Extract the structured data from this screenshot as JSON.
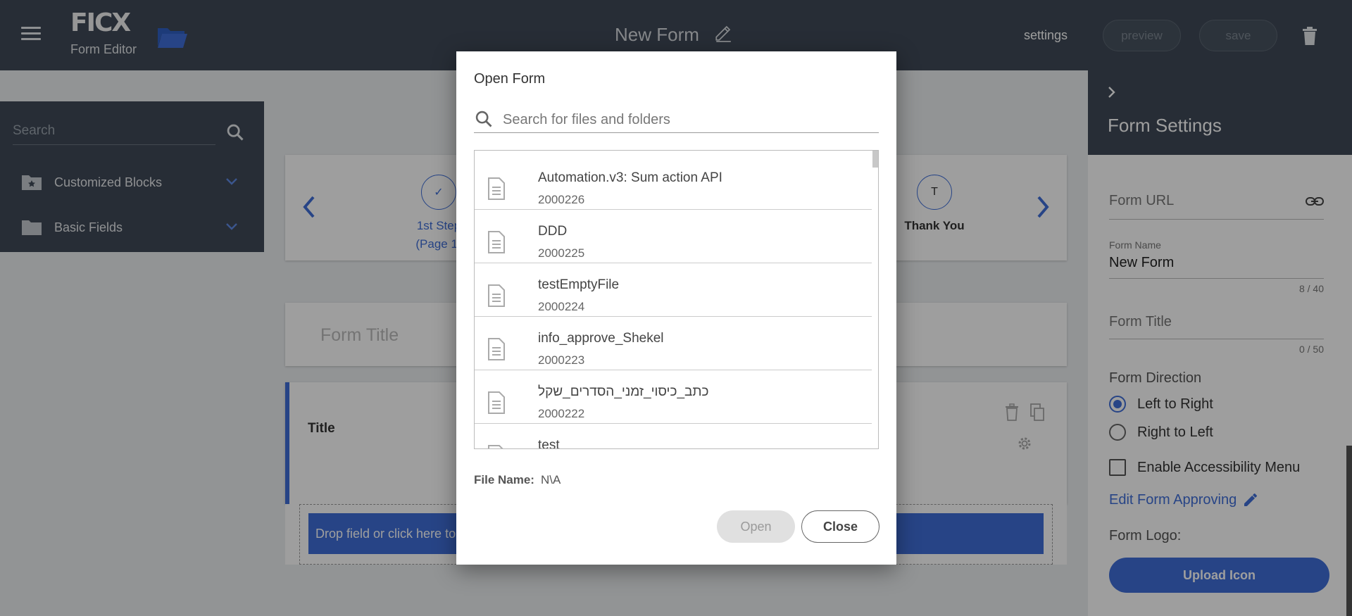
{
  "header": {
    "logo": "FICX",
    "subtitle": "Form Editor",
    "form_name": "New Form",
    "settings_label": "settings",
    "preview_label": "preview",
    "save_label": "save"
  },
  "left_panel": {
    "search_placeholder": "Search",
    "categories": [
      {
        "label": "Customized Blocks"
      },
      {
        "label": "Basic Fields"
      }
    ]
  },
  "steps": [
    {
      "circle": "✓",
      "label_line1": "1st Step",
      "label_line2": "(Page 1)"
    },
    {
      "circle": "T",
      "label_line1": "Thank You",
      "label_line2": ""
    }
  ],
  "canvas": {
    "form_title_placeholder": "Form Title",
    "block_title": "Title",
    "drop_text": "Drop field or click here to a"
  },
  "right_panel": {
    "title": "Form Settings",
    "form_url_placeholder": "Form URL",
    "form_name_label": "Form Name",
    "form_name_value": "New Form",
    "form_name_counter": "8 / 40",
    "form_title_placeholder": "Form Title",
    "form_title_counter": "0 / 50",
    "direction_label": "Form Direction",
    "direction_options": [
      "Left to Right",
      "Right to Left"
    ],
    "direction_selected": "Left to Right",
    "accessibility_label": "Enable Accessibility Menu",
    "edit_approving_label": "Edit Form Approving",
    "logo_label": "Form Logo:",
    "upload_label": "Upload Icon"
  },
  "modal": {
    "title": "Open Form",
    "search_placeholder": "Search for files and folders",
    "files": [
      {
        "name": "Automation.v3: Sum action API",
        "id": "2000226"
      },
      {
        "name": "DDD",
        "id": "2000225"
      },
      {
        "name": "testEmptyFile",
        "id": "2000224"
      },
      {
        "name": "info_approve_Shekel",
        "id": "2000223"
      },
      {
        "name": "כתב_כיסוי_זמני_הסדרים_שקל",
        "id": "2000222"
      },
      {
        "name": "test",
        "id": ""
      }
    ],
    "file_name_label": "File Name:",
    "file_name_value": "N\\A",
    "open_label": "Open",
    "close_label": "Close"
  },
  "colors": {
    "header_bg": "#3f4a57",
    "accent": "#3f6fd9"
  }
}
